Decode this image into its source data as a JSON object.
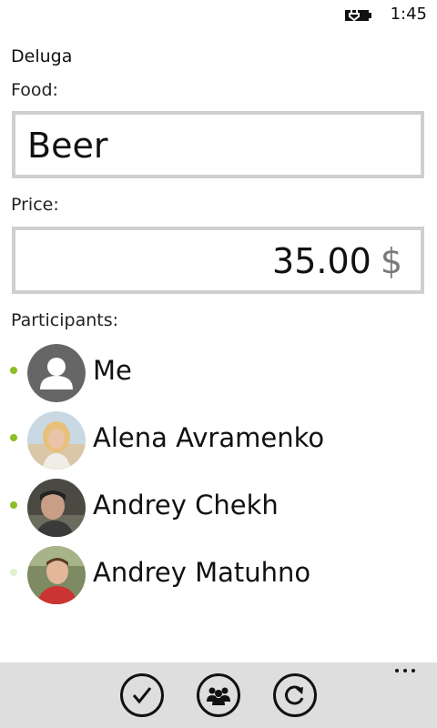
{
  "status": {
    "time": "1:45"
  },
  "app": {
    "title": "Deluga"
  },
  "food": {
    "label": "Food:",
    "value": "Beer"
  },
  "price": {
    "label": "Price:",
    "value": "35.00",
    "currency": "$"
  },
  "participants": {
    "label": "Participants:",
    "items": [
      {
        "name": "Me",
        "selected": true,
        "avatar": "default-person"
      },
      {
        "name": "Alena Avramenko",
        "selected": true,
        "avatar": "photo"
      },
      {
        "name": "Andrey Chekh",
        "selected": true,
        "avatar": "photo"
      },
      {
        "name": "Andrey Matuhno",
        "selected": false,
        "avatar": "photo"
      }
    ]
  },
  "appbar": {
    "buttons": [
      "check-icon",
      "people-icon",
      "refresh-icon"
    ],
    "more": "more-icon"
  },
  "colors": {
    "accent": "#8cbf26",
    "accent_faded": "#e3efcf",
    "textbox_border": "#cfcfcf",
    "appbar_bg": "#dedede"
  }
}
